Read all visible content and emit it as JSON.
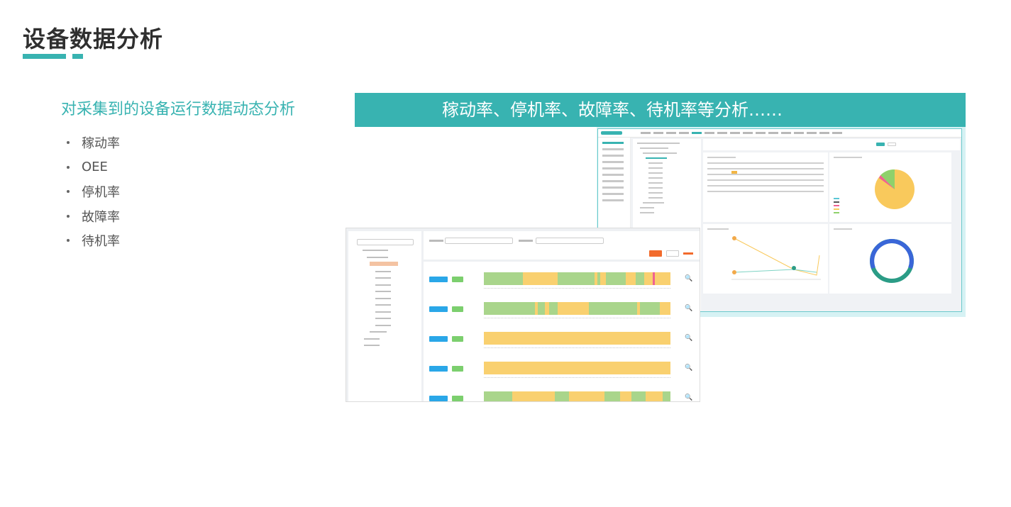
{
  "page": {
    "title": "设备数据分析",
    "subtitle": "对采集到的设备运行数据动态分析",
    "bullets": [
      "稼动率",
      "OEE",
      "停机率",
      "故障率",
      "待机率"
    ],
    "banner": "稼动率、停机率、故障率、待机率等分析……"
  },
  "colors": {
    "accent": "#38b3b1",
    "run_green": "#a9d58b",
    "idle_yellow": "#f9d06f",
    "fault_pink": "#f06292",
    "device_tag_blue": "#2aa7e8"
  },
  "icons": [
    "magnifier-icon",
    "bullet-dot-icon"
  ]
}
